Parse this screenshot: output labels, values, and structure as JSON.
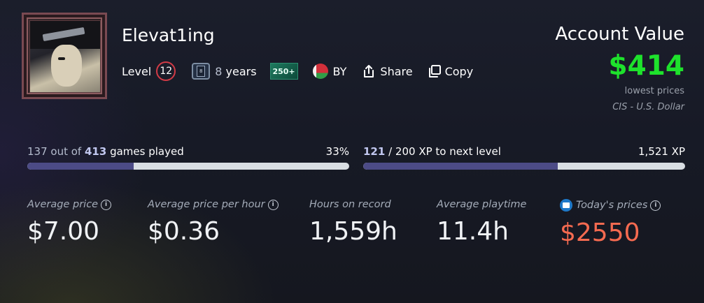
{
  "profile": {
    "username": "Elevat1ing",
    "level_label": "Level",
    "level": "12",
    "years_badge": "8",
    "years_num": "8",
    "years_word": "years",
    "games_badge": "250+",
    "country": "BY",
    "share_label": "Share",
    "copy_label": "Copy"
  },
  "account": {
    "title": "Account Value",
    "value": "$414",
    "sub1": "lowest prices",
    "sub2": "CIS - U.S. Dollar"
  },
  "games_progress": {
    "played": "137",
    "mid": "out of",
    "total": "413",
    "suffix": "games played",
    "percent_label": "33%",
    "fill_percent": 33
  },
  "xp_progress": {
    "current": "121",
    "rest": "/ 200 XP to next level",
    "total_label": "1,521 XP",
    "fill_percent": 60.5
  },
  "stats": [
    {
      "label": "Average price",
      "value": "$7.00"
    },
    {
      "label": "Average price per hour",
      "value": "$0.36"
    },
    {
      "label": "Hours on record",
      "value": "1,559h"
    },
    {
      "label": "Average playtime",
      "value": "11.4h"
    },
    {
      "label": "Today's prices",
      "value": "$2550"
    }
  ],
  "colors": {
    "account_value": "#1ee22c",
    "level_ring": "#d23b46",
    "today_price": "#f56a50",
    "progress_fill": "#4c4b86"
  },
  "icons": [
    "info-icon",
    "share-icon",
    "copy-icon",
    "flag-icon",
    "years-icon"
  ]
}
